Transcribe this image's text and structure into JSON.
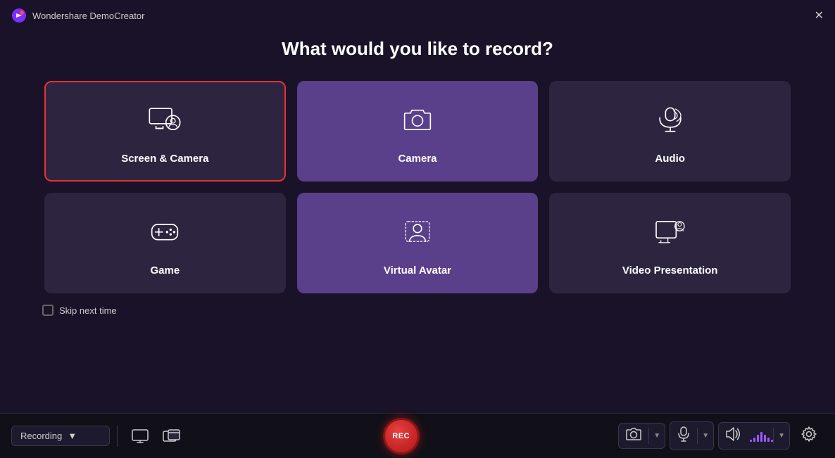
{
  "titleBar": {
    "appName": "Wondershare DemoCreator",
    "closeLabel": "✕"
  },
  "pageTitle": "What would you like to record?",
  "options": [
    {
      "id": "screen-camera",
      "label": "Screen & Camera",
      "selected": true,
      "purpleBg": false,
      "iconType": "screen-camera"
    },
    {
      "id": "camera",
      "label": "Camera",
      "selected": false,
      "purpleBg": true,
      "iconType": "camera"
    },
    {
      "id": "audio",
      "label": "Audio",
      "selected": false,
      "purpleBg": false,
      "iconType": "audio"
    },
    {
      "id": "game",
      "label": "Game",
      "selected": false,
      "purpleBg": false,
      "iconType": "game"
    },
    {
      "id": "virtual-avatar",
      "label": "Virtual Avatar",
      "selected": false,
      "purpleBg": true,
      "iconType": "virtual-avatar"
    },
    {
      "id": "video-presentation",
      "label": "Video Presentation",
      "selected": false,
      "purpleBg": false,
      "iconType": "video-presentation"
    }
  ],
  "skipLabel": "Skip next time",
  "toolbar": {
    "recordingDropdown": "Recording",
    "recButton": "REC",
    "screenIcon": "screen",
    "windowIcon": "window"
  },
  "volumeBars": [
    3,
    6,
    10,
    14,
    10,
    6,
    3
  ]
}
